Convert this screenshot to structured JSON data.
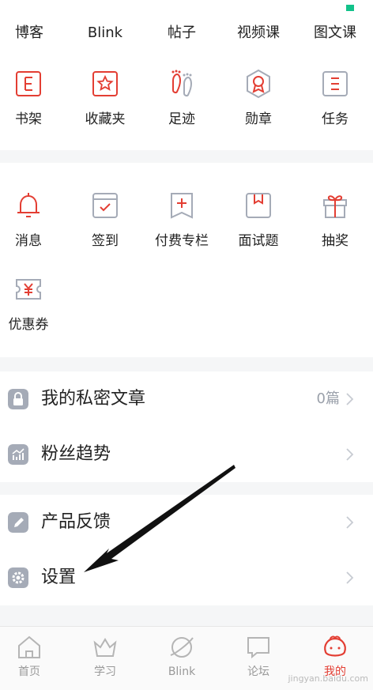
{
  "colors": {
    "accent": "#e33e33",
    "icon_gray": "#a5abb7",
    "muted_text": "#9aa0aa",
    "badge_green": "#12c28a"
  },
  "tabs": [
    "博客",
    "Blink",
    "帖子",
    "视频课",
    "图文课"
  ],
  "features": [
    {
      "label": "书架",
      "icon": "bookshelf-icon"
    },
    {
      "label": "收藏夹",
      "icon": "star-icon"
    },
    {
      "label": "足迹",
      "icon": "footprint-icon"
    },
    {
      "label": "勋章",
      "icon": "medal-icon"
    },
    {
      "label": "任务",
      "icon": "task-icon"
    }
  ],
  "services": [
    {
      "label": "消息",
      "icon": "bell-icon"
    },
    {
      "label": "签到",
      "icon": "checkin-icon"
    },
    {
      "label": "付费专栏",
      "icon": "paid-column-icon"
    },
    {
      "label": "面试题",
      "icon": "interview-icon"
    },
    {
      "label": "抽奖",
      "icon": "gift-icon"
    },
    {
      "label": "优惠券",
      "icon": "coupon-icon"
    }
  ],
  "menu": {
    "private_articles": {
      "label": "我的私密文章",
      "value": "0篇"
    },
    "fan_trend": {
      "label": "粉丝趋势"
    },
    "feedback": {
      "label": "产品反馈"
    },
    "settings": {
      "label": "设置"
    }
  },
  "bottom_nav": [
    {
      "label": "首页",
      "icon": "home-icon"
    },
    {
      "label": "学习",
      "icon": "crown-icon"
    },
    {
      "label": "Blink",
      "icon": "planet-icon"
    },
    {
      "label": "论坛",
      "icon": "chat-icon"
    },
    {
      "label": "我的",
      "icon": "profile-icon",
      "active": true
    }
  ],
  "watermark": "jingyan.baidu.com"
}
